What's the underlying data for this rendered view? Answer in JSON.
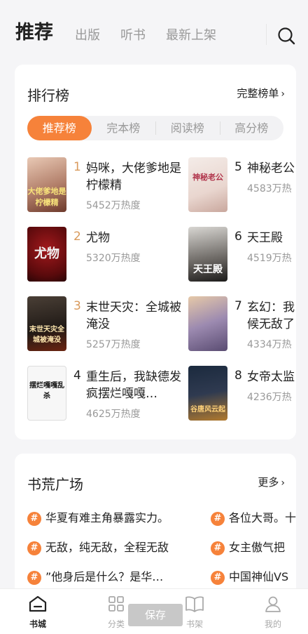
{
  "nav": {
    "tabs": [
      "推荐",
      "出版",
      "听书",
      "最新上架"
    ]
  },
  "ranking": {
    "title": "排行榜",
    "full_list": "完整榜单",
    "segments": [
      "推荐榜",
      "完本榜",
      "阅读榜",
      "高分榜"
    ],
    "books": [
      {
        "rank": "1",
        "title": "妈咪，大佬爹地是柠檬精",
        "heat": "5452万热度",
        "cover_text": "大佬爹地是柠檬精"
      },
      {
        "rank": "2",
        "title": "尤物",
        "heat": "5320万热度",
        "cover_text": "尤物"
      },
      {
        "rank": "3",
        "title": "末世天灾：全城被淹没",
        "heat": "5257万热度",
        "cover_text": "末世天灾全城被淹没"
      },
      {
        "rank": "4",
        "title": "重生后，我缺德发疯摆烂嘎嘎…",
        "heat": "4625万热度",
        "cover_text": "摆烂嘎嘎乱杀"
      },
      {
        "rank": "5",
        "title": "神秘老公",
        "heat": "4583万热",
        "cover_text": "神秘老公"
      },
      {
        "rank": "6",
        "title": "天王殿",
        "heat": "4519万热",
        "cover_text": "天王殿"
      },
      {
        "rank": "7",
        "title": "玄幻：我",
        "title_line2": "候无敌了",
        "heat": "4334万热",
        "cover_text": ""
      },
      {
        "rank": "8",
        "title": "女帝太监",
        "heat": "4236万热",
        "cover_text": "谷唐风云起"
      }
    ]
  },
  "forum": {
    "title": "书荒广场",
    "more": "更多",
    "topics_left": [
      "华夏有难主角暴露实力。",
      "无敌，纯无敌，全程无敌",
      "”他身后是什么？是华…"
    ],
    "topics_right": [
      "各位大哥。十",
      "女主傲气把",
      "中国神仙VS"
    ]
  },
  "bottom": {
    "items": [
      "书城",
      "分类",
      "书架",
      "我的"
    ],
    "save": "保存"
  },
  "colors": {
    "accent": "#f6823a",
    "rank_top": "#d99a5c"
  }
}
